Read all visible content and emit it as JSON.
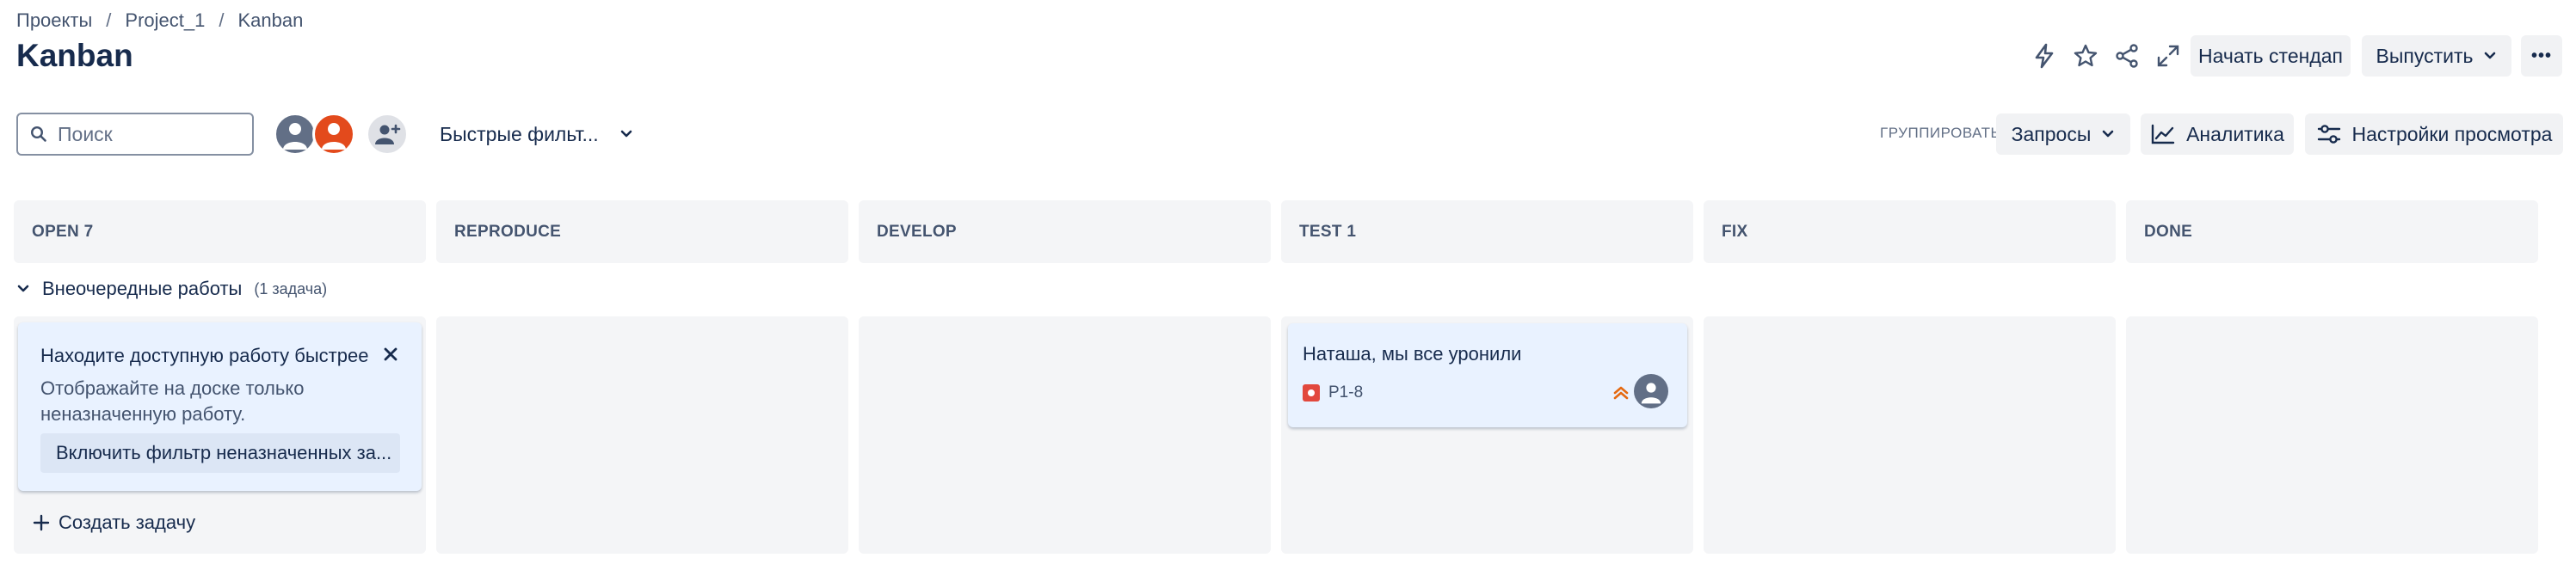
{
  "breadcrumb": {
    "items": [
      "Проекты",
      "Project_1",
      "Kanban"
    ],
    "separator": "/"
  },
  "page_title": "Kanban",
  "header_actions": {
    "icons": [
      "lightning-icon",
      "star-icon",
      "share-icon",
      "expand-icon"
    ],
    "start_standup": "Начать стендап",
    "release": "Выпустить",
    "more": "•••"
  },
  "search": {
    "placeholder": "Поиск",
    "value": ""
  },
  "quick_filters": "Быстрые фильт...",
  "group_label": "ГРУППИРОВАТЬ",
  "group_value": "Запросы",
  "analytics": "Аналитика",
  "view_settings": "Настройки просмотра",
  "columns": [
    "OPEN 7",
    "REPRODUCE",
    "DEVELOP",
    "TEST 1",
    "FIX",
    "DONE"
  ],
  "swimlane": {
    "title": "Внеочередные работы",
    "count": "(1 задача)"
  },
  "tip": {
    "title": "Находите доступную работу быстрее",
    "description": "Отображайте на доске только неназначенную работу.",
    "button": "Включить фильтр неназначенных за..."
  },
  "create_task": "Создать задачу",
  "issue": {
    "title": "Наташа, мы все уронили",
    "key": "P1-8",
    "type": "bug",
    "priority": "highest"
  },
  "colors": {
    "text": "#172b4d",
    "subtle": "#44546f",
    "column_bg": "#f4f5f7",
    "card_bg": "#e9f2ff",
    "bug_red": "#e2483d",
    "priority_orange": "#e56910",
    "avatar_orange": "#e34a1c"
  }
}
